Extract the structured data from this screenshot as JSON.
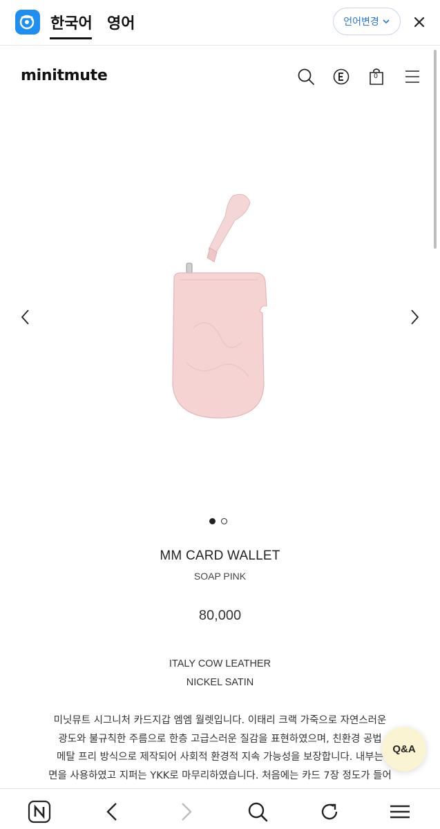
{
  "translate_bar": {
    "tab_korean": "한국어",
    "tab_english": "영어",
    "change_language": "언어변경"
  },
  "header": {
    "brand": "minitmute",
    "cart_count": "0"
  },
  "gallery": {
    "total_images": 2,
    "current_image": 1,
    "product_color_hex": "#f4d3d3"
  },
  "product": {
    "name": "MM CARD WALLET",
    "color": "SOAP PINK",
    "price": "80,000",
    "material": "ITALY COW LEATHER",
    "hardware": "NICKEL SATIN",
    "description_lines": [
      "미닛뮤트 시그니처 카드지갑 엠엠 월렛입니다. 이태리 크랙 가죽으로 자연스러운",
      "광도와 불규칙한 주름으로 한층 고급스러운 질감을 표현하였으며, 친환경 공법",
      "메탈 프리 방식으로 제작되어 사회적 환경적 지속 가능성을 보장합니다. 내부는",
      "면을 사용하였고 지퍼는 YKK로 마무리하였습니다. 처음에는 카드 7장 정도가 들어"
    ]
  },
  "floating": {
    "qna_label": "Q&A"
  }
}
